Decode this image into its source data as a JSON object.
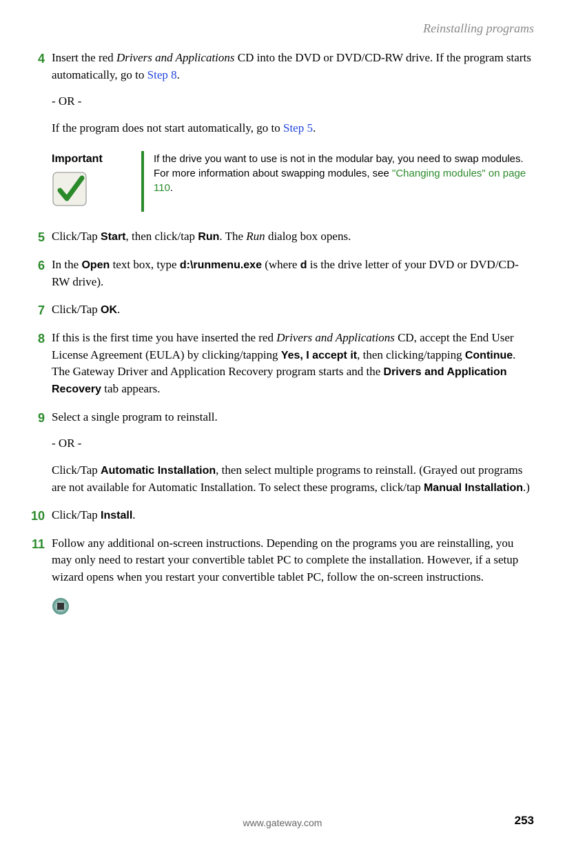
{
  "header": {
    "title": "Reinstalling programs"
  },
  "steps": [
    {
      "num": "4",
      "intro1": "Insert the red ",
      "italic1": "Drivers and Applications",
      "intro2": " CD into the DVD or DVD/CD-RW drive. If the program starts automatically, go to ",
      "link1": "Step 8",
      "intro3": ".",
      "or": "- OR -",
      "cont1": "If the program does not start automatically, go to ",
      "link2": "Step 5",
      "cont2": "."
    },
    {
      "num": "5",
      "t1": "Click/Tap ",
      "b1": "Start",
      "t2": ", then click/tap ",
      "b2": "Run",
      "t3": ". The ",
      "i1": "Run",
      "t4": " dialog box opens."
    },
    {
      "num": "6",
      "t1": "In the ",
      "b1": "Open",
      "t2": " text box, type ",
      "b2": "d:\\runmenu.exe",
      "t3": " (where ",
      "b3": "d",
      "t4": " is the drive letter of your DVD or DVD/CD-RW drive)."
    },
    {
      "num": "7",
      "t1": "Click/Tap ",
      "b1": "OK",
      "t2": "."
    },
    {
      "num": "8",
      "t1": "If this is the first time you have inserted the red ",
      "i1": "Drivers and Applications",
      "t2": " CD, accept the End User License Agreement (EULA) by clicking/tapping ",
      "b1": "Yes, I accept it",
      "t3": ", then clicking/tapping ",
      "b2": "Continue",
      "t4": ". The Gateway Driver and Application Recovery program starts and the ",
      "b3": "Drivers and Application Recovery",
      "t5": " tab appears."
    },
    {
      "num": "9",
      "t1": "Select a single program to reinstall.",
      "or": "- OR -",
      "c1": "Click/Tap ",
      "cb1": "Automatic Installation",
      "c2": ", then select multiple programs to reinstall. (Grayed out programs are not available for Automatic Installation. To select these programs, click/tap ",
      "cb2": "Manual Installation",
      "c3": ".)"
    },
    {
      "num": "10",
      "t1": "Click/Tap ",
      "b1": "Install",
      "t2": "."
    },
    {
      "num": "11",
      "t1": "Follow any additional on-screen instructions. Depending on the programs you are reinstalling, you may only need to restart your convertible tablet PC to complete the installation. However, if a setup wizard opens when you restart your convertible tablet PC, follow the on-screen instructions."
    }
  ],
  "callout": {
    "label": "Important",
    "body1": "If the drive you want to use is not in the modular bay, you need to swap modules. For more information about swapping modules, see ",
    "link": "\"Changing modules\" on page 110",
    "body2": "."
  },
  "footer": {
    "url": "www.gateway.com",
    "page": "253"
  }
}
